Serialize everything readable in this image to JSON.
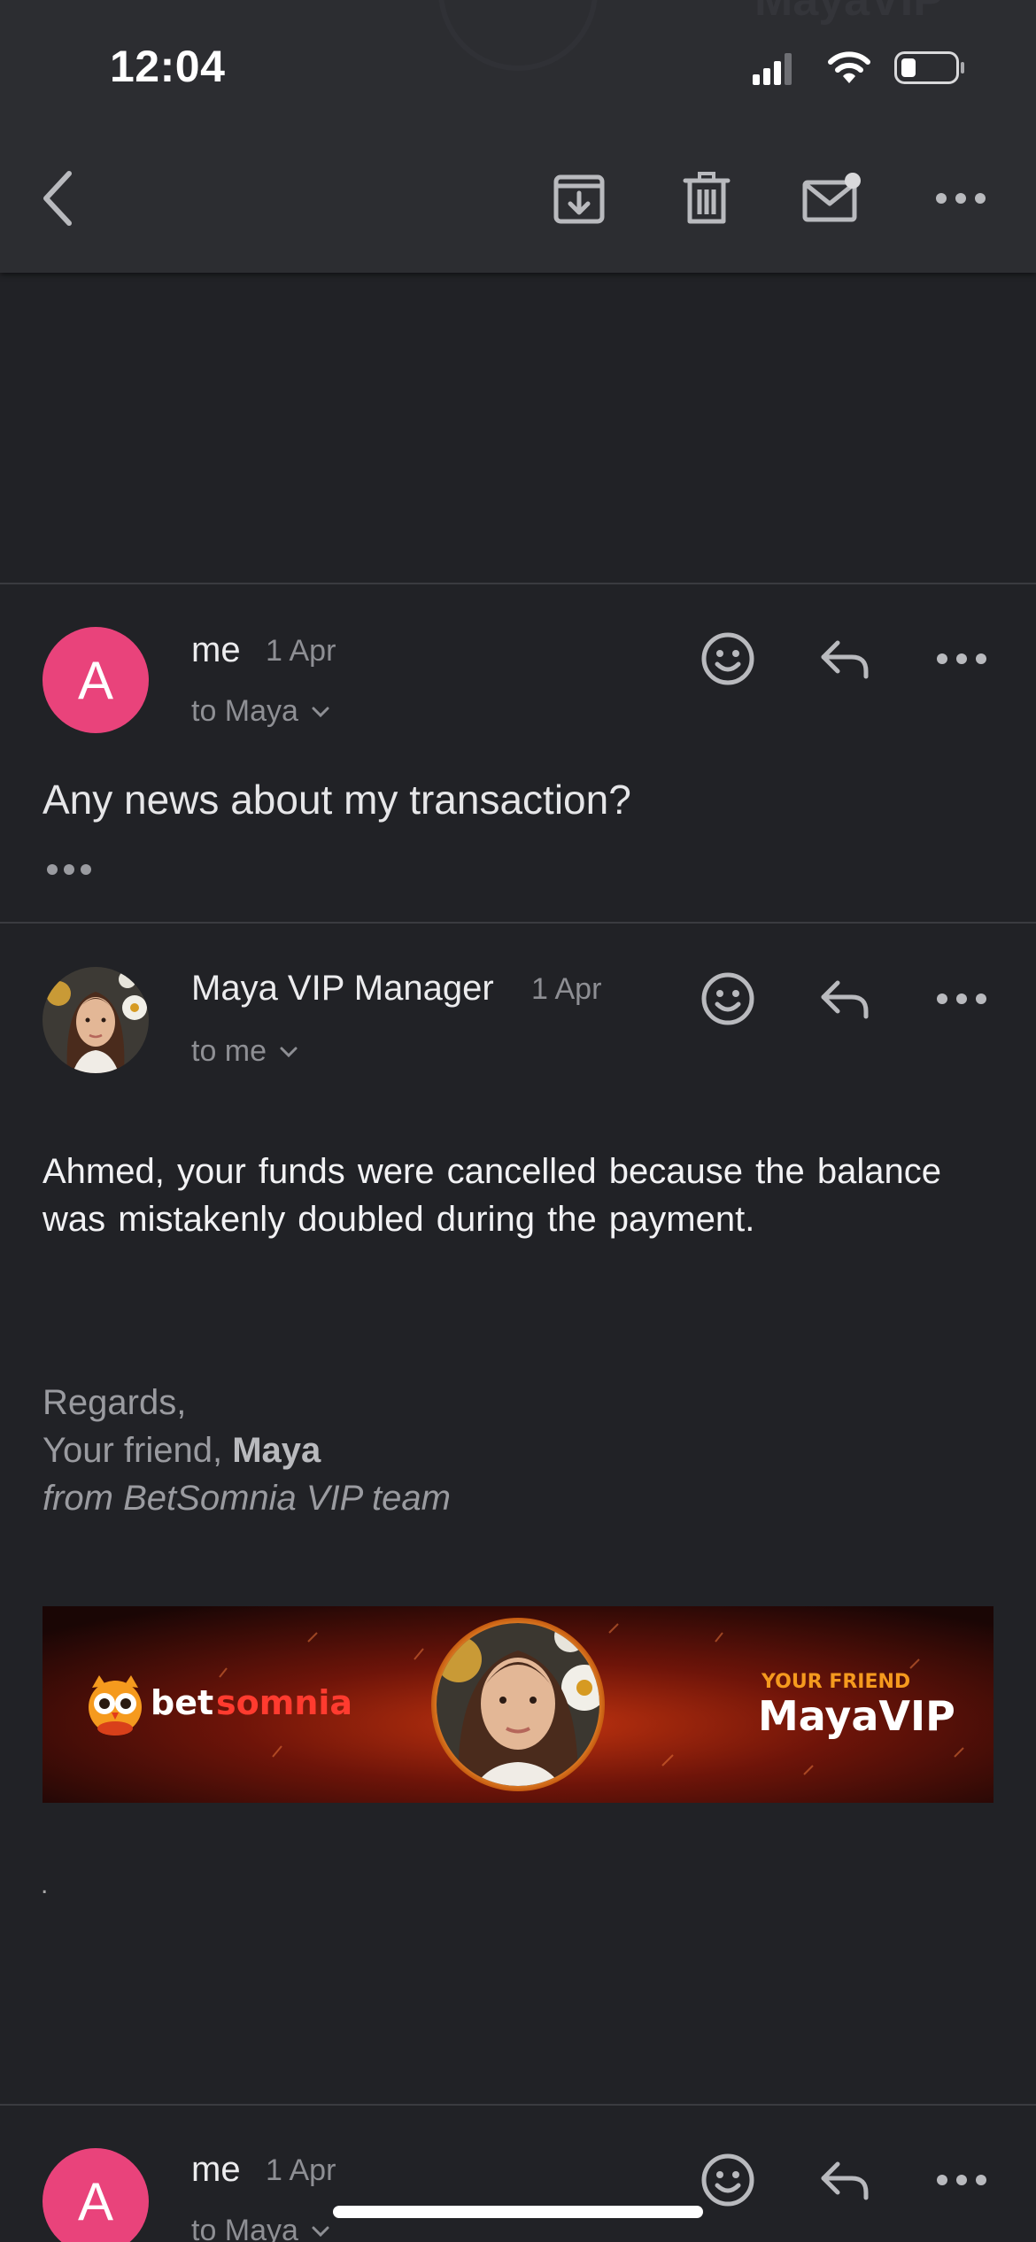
{
  "status_bar": {
    "time": "12:04"
  },
  "header_ghost": {
    "left_text": "",
    "right_text": "MayaVIP"
  },
  "toolbar": {
    "icons": [
      "back-chevron-icon",
      "archive-icon",
      "trash-icon",
      "mark-unread-icon",
      "more-icon"
    ]
  },
  "thread": {
    "messages": [
      {
        "sender": "me",
        "date": "1 Apr",
        "avatar_letter": "A",
        "avatar_color": "#e9437b",
        "recipient": "to Maya",
        "preview": "Any news about my transaction?"
      },
      {
        "sender": "Maya VIP Manager",
        "date": "1 Apr",
        "recipient": "to me",
        "body": "Ahmed, your funds were cancelled because the balance was mistakenly doubled during the payment.",
        "signature": {
          "line1": "Regards,",
          "line2_prefix": "Your friend,",
          "line2_name": "Maya",
          "line3": "from BetSomnia VIP team"
        },
        "banner": {
          "brand_part1": "bet",
          "brand_part2": "somnia",
          "tagline": "YOUR FRIEND",
          "headline": "MayaVIP"
        },
        "trailing_text": "."
      },
      {
        "sender": "me",
        "date": "1 Apr",
        "avatar_letter": "A",
        "avatar_color": "#e9437b",
        "recipient": "to Maya"
      }
    ]
  },
  "colors": {
    "background": "#212226",
    "header": "#2c2d31",
    "accent_avatar": "#e9437b",
    "banner_red": "#8e1a0c",
    "banner_orange": "#f59a1e"
  }
}
